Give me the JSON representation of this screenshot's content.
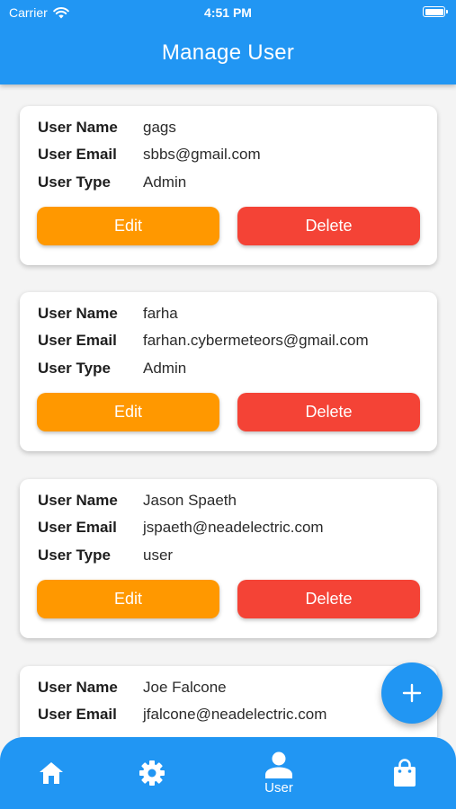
{
  "status_bar": {
    "carrier": "Carrier",
    "time": "4:51 PM"
  },
  "header": {
    "title": "Manage User"
  },
  "labels": {
    "name": "User Name",
    "email": "User Email",
    "type": "User Type"
  },
  "buttons": {
    "edit": "Edit",
    "delete": "Delete"
  },
  "users": [
    {
      "name": "gags",
      "email": "sbbs@gmail.com",
      "type": "Admin"
    },
    {
      "name": "farha",
      "email": "farhan.cybermeteors@gmail.com",
      "type": "Admin"
    },
    {
      "name": "Jason Spaeth",
      "email": "jspaeth@neadelectric.com",
      "type": "user"
    },
    {
      "name": "Joe Falcone",
      "email": "jfalcone@neadelectric.com",
      "type": ""
    }
  ],
  "bottom_nav": {
    "items": [
      {
        "icon": "home-icon",
        "label": ""
      },
      {
        "icon": "gear-icon",
        "label": ""
      },
      {
        "icon": "person-icon",
        "label": "User"
      },
      {
        "icon": "shopping-bag-icon",
        "label": ""
      }
    ]
  },
  "colors": {
    "primary": "#2196f3",
    "edit": "#ff9800",
    "delete": "#f44336",
    "background": "#f4f4f4"
  }
}
